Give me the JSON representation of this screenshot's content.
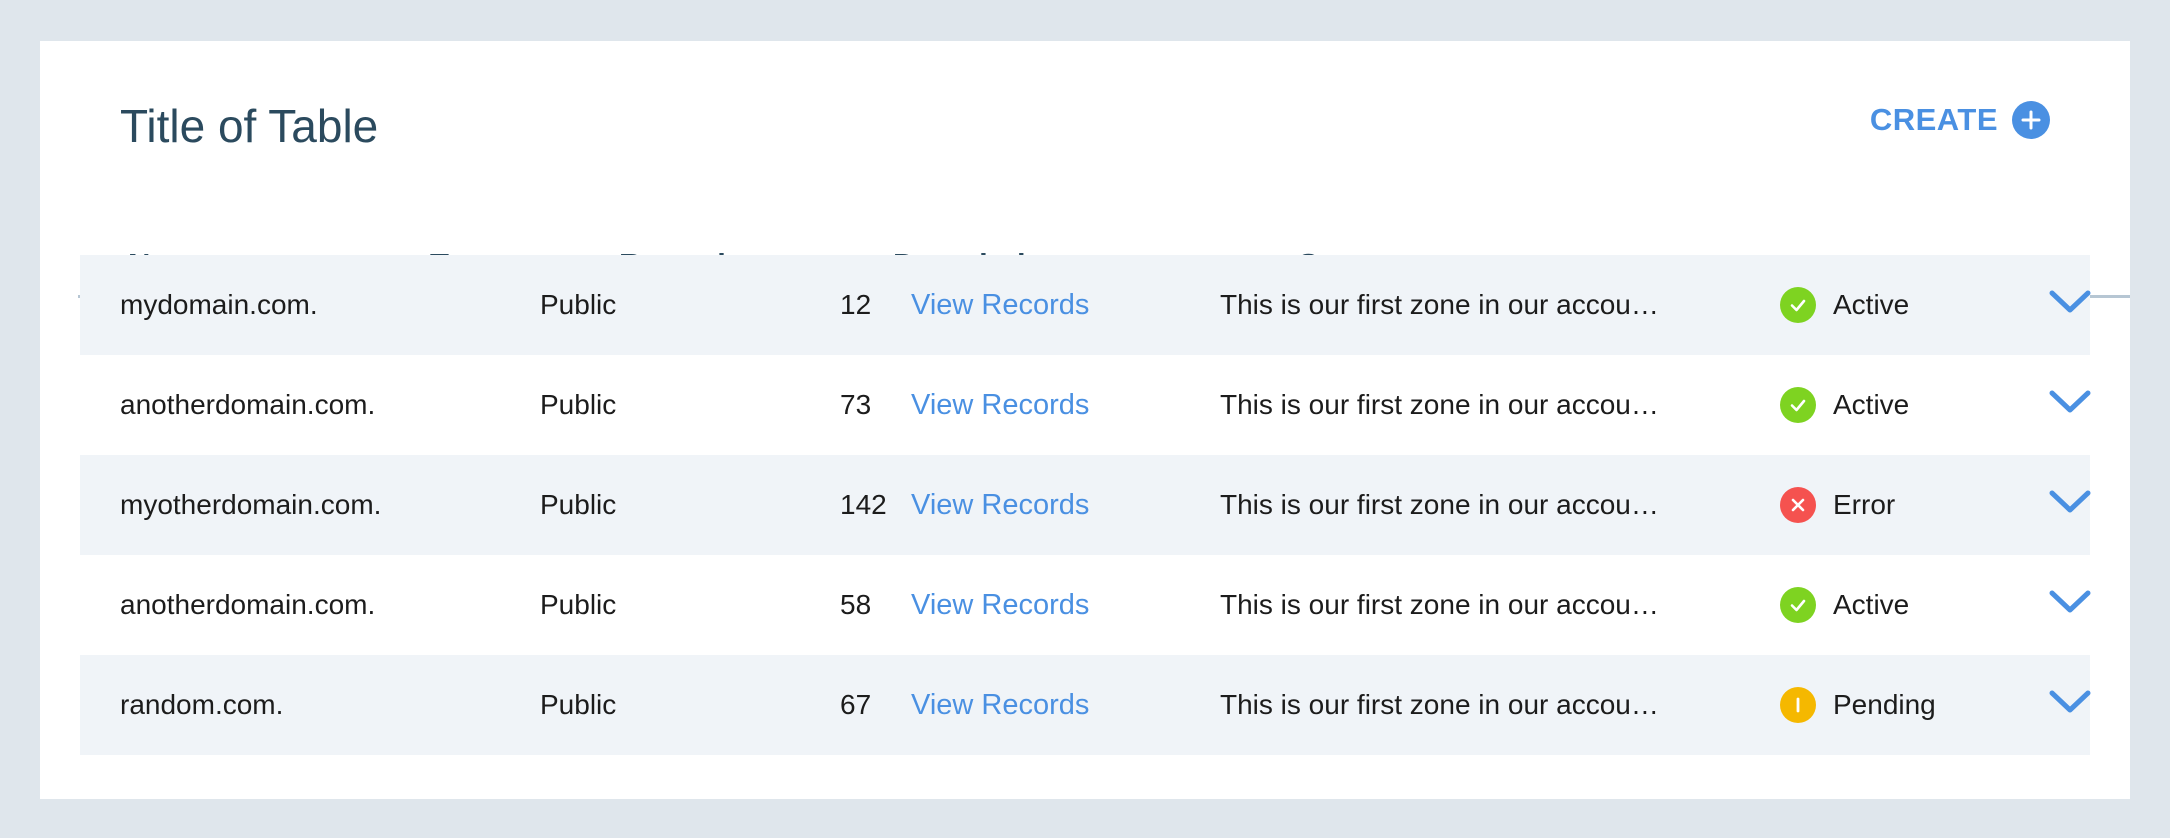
{
  "title": "Title of Table",
  "create": {
    "label": "CREATE",
    "icon": "plus-circle-icon"
  },
  "columns": {
    "name": "Name",
    "type": "Type",
    "records": "Records",
    "description": "Description",
    "status": "Status"
  },
  "rows": [
    {
      "name": "mydomain.com.",
      "type": "Public",
      "count": "12",
      "link": "View Records",
      "description": "This is our first zone in our accou…",
      "status": "Active",
      "status_kind": "active"
    },
    {
      "name": "anotherdomain.com.",
      "type": "Public",
      "count": "73",
      "link": "View Records",
      "description": "This is our first zone in our accou…",
      "status": "Active",
      "status_kind": "active"
    },
    {
      "name": "myotherdomain.com.",
      "type": "Public",
      "count": "142",
      "link": "View Records",
      "description": "This is our first zone in our accou…",
      "status": "Error",
      "status_kind": "error"
    },
    {
      "name": "anotherdomain.com.",
      "type": "Public",
      "count": "58",
      "link": "View Records",
      "description": "This is our first zone in our accou…",
      "status": "Active",
      "status_kind": "active"
    },
    {
      "name": "random.com.",
      "type": "Public",
      "count": "67",
      "link": "View Records",
      "description": "This is our first zone in our accou…",
      "status": "Pending",
      "status_kind": "pending"
    }
  ],
  "colors": {
    "accent": "#4a90e2",
    "active": "#7ed321",
    "error": "#f5524f",
    "pending": "#f5b800",
    "header_text": "#2b4a5e",
    "row_shade": "#f0f4f8"
  }
}
